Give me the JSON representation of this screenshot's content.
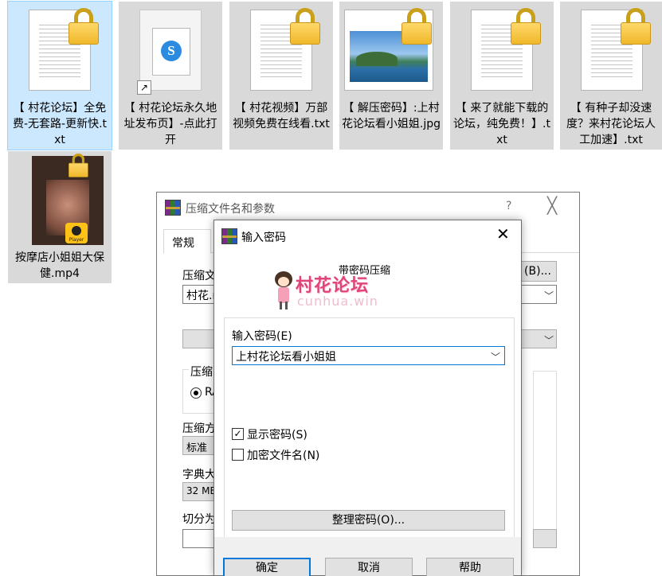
{
  "files": [
    {
      "caption": "【 村花论坛】全免费-无套路-更新快.txt",
      "kind": "txt",
      "selected": true
    },
    {
      "caption": "【 村花论坛永久地址发布页】-点此打开",
      "kind": "lnk",
      "logo_letter": "S"
    },
    {
      "caption": "【 村花视频】万部视频免费在线看.txt",
      "kind": "txt"
    },
    {
      "caption": "【 解压密码】:上村花论坛看小姐姐.jpg",
      "kind": "jpg"
    },
    {
      "caption": "【 来了就能下载的论坛，纯免费！】.txt",
      "kind": "txt"
    },
    {
      "caption": "【 有种子却没速度？来村花论坛人工加速】.txt",
      "kind": "txt"
    },
    {
      "caption": "按摩店小姐姐大保健.mp4",
      "kind": "mp4",
      "player_label": "Player"
    }
  ],
  "back_dialog": {
    "title": "压缩文件名和参数",
    "help_glyph": "?",
    "close_glyph": "╳",
    "tab_general": "常规",
    "archive_label": "压缩文",
    "browse_button": "(B)...",
    "archive_name": "村花.r",
    "format_group": "压缩",
    "format_rar": "RA",
    "method_label": "压缩方",
    "method_value": "标准",
    "dict_label": "字典大",
    "dict_value": "32 MB",
    "split_label": "切分为"
  },
  "password_dialog": {
    "title": "输入密码",
    "close_glyph": "✕",
    "subtitle": "带密码压缩",
    "watermark_main": "村花论坛",
    "watermark_sub": "cunhua.win",
    "password_label": "输入密码(E)",
    "password_value": "上村花论坛看小姐姐",
    "show_password_label": "显示密码(S)",
    "show_password_checked": true,
    "encrypt_names_label": "加密文件名(N)",
    "encrypt_names_checked": false,
    "organize_button": "整理密码(O)...",
    "ok_button": "确定",
    "cancel_button": "取消",
    "help_button": "帮助"
  },
  "icons": {
    "lock": "padlock-icon",
    "winrar": "winrar-icon",
    "chevron": "chevron-down-icon",
    "shortcut": "shortcut-arrow-icon"
  },
  "colors": {
    "selection": "#cce8ff",
    "tile": "#d9d9d9",
    "accent": "#0078d7",
    "watermark": "#e0457a"
  }
}
